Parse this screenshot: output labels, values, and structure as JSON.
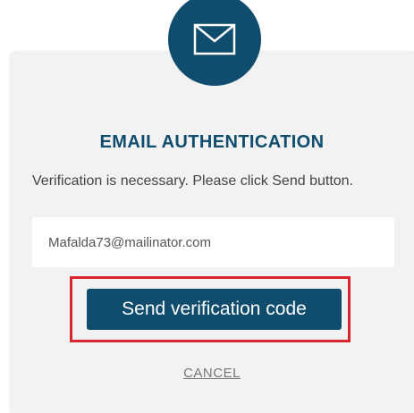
{
  "dialog": {
    "title": "EMAIL AUTHENTICATION",
    "icon": "envelope-icon",
    "description": "Verification is necessary. Please click Send button.",
    "email_value": "Mafalda73@mailinator.com",
    "send_label": "Send verification code",
    "cancel_label": "CANCEL"
  },
  "colors": {
    "primary": "#0f4c6e",
    "highlight": "#d8262f",
    "card_background": "#f2f2f2"
  }
}
